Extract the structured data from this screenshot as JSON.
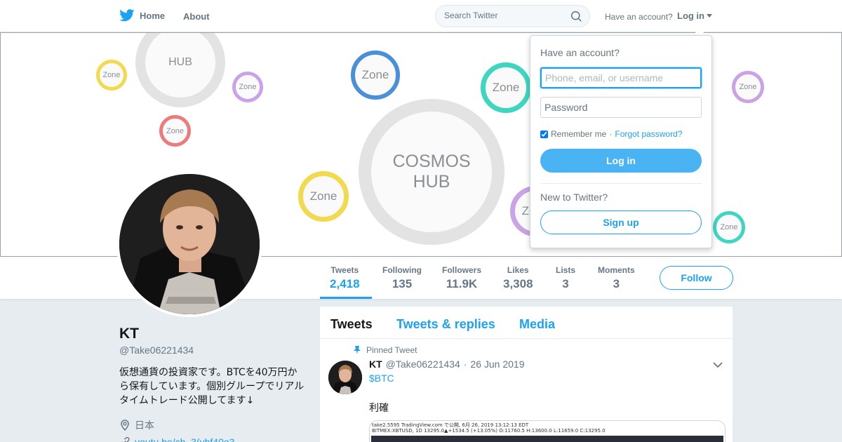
{
  "nav": {
    "home_label": "Home",
    "about_label": "About",
    "search_placeholder": "Search Twitter",
    "have_account_text": "Have an account?",
    "login_label": "Log in"
  },
  "banner": {
    "center_text_line1": "COSMOS",
    "center_text_line2": "HUB",
    "hub_text": "HUB",
    "zone_text": "Zone"
  },
  "stats": [
    {
      "label": "Tweets",
      "value": "2,418"
    },
    {
      "label": "Following",
      "value": "135"
    },
    {
      "label": "Followers",
      "value": "11.9K"
    },
    {
      "label": "Likes",
      "value": "3,308"
    },
    {
      "label": "Lists",
      "value": "3"
    },
    {
      "label": "Moments",
      "value": "3"
    }
  ],
  "follow_label": "Follow",
  "profile": {
    "name": "KT",
    "handle": "@Take06221434",
    "bio": "仮想通貨の投資家です。BTCを40万円から保有しています。個別グループでリアルタイムトレード公開してます↓",
    "location": "日本",
    "link": "youtu.be/ch_3(ybf40o3..."
  },
  "timeline": {
    "tabs": [
      "Tweets",
      "Tweets & replies",
      "Media"
    ],
    "pinned_label": "Pinned Tweet",
    "tweet": {
      "name": "KT",
      "handle": "@Take06221434",
      "sep": "·",
      "date": "26 Jun 2019",
      "cashtag": "$BTC",
      "text": "利確",
      "media_line1": "take2.5595 TradingView.com で公開, 6月 26, 2019 13:12:13 EDT",
      "media_line2": "BITMEX:XBTUSD, 1D 13295.0▲+1534.5 (+13.05%) O:11760.5 H:13600.0 L:11659.0 C:13295.0"
    }
  },
  "login_dropdown": {
    "title": "Have an account?",
    "username_placeholder": "Phone, email, or username",
    "password_placeholder": "Password",
    "remember_label": "Remember me",
    "dot": "·",
    "forgot_label": "Forgot password?",
    "login_button": "Log in",
    "new_text": "New to Twitter?",
    "signup_button": "Sign up"
  },
  "colors": {
    "accent": "#1da1f2",
    "background": "#e6ecf0",
    "zone_yellow": "#f2d94e",
    "zone_purple": "#c9a3e6",
    "zone_red": "#ec7c7c",
    "zone_blue": "#4a90d9",
    "zone_teal": "#3ed6c0"
  },
  "icons": [
    "twitter-bird-icon",
    "search-icon",
    "caret-down-icon",
    "pin-icon",
    "location-icon",
    "link-icon",
    "chevron-down-icon"
  ]
}
